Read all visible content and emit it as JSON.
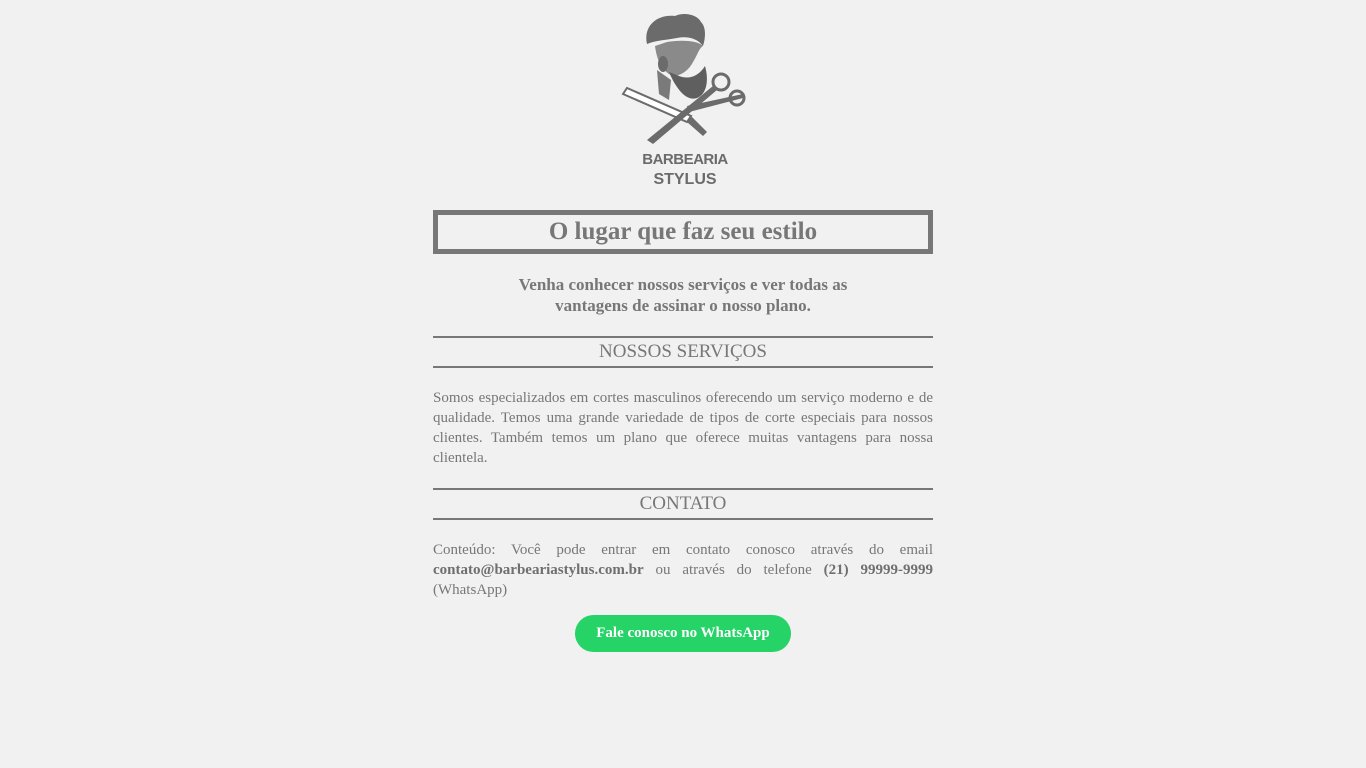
{
  "brand": {
    "line1": "BARBEARIA",
    "line2": "STYLUS"
  },
  "hero": {
    "headline": "O lugar que faz seu estilo",
    "intro_line1": "Venha conhecer nossos serviços e ver todas as",
    "intro_line2": "vantagens de assinar o nosso plano."
  },
  "services": {
    "title": "NOSSOS SERVIÇOS",
    "text": "Somos especializados em cortes masculinos oferecendo um serviço moderno e de qualidade. Temos uma grande variedade de tipos de corte especiais para nossos clientes. Também temos um plano que oferece muitas vantagens para nossa clientela."
  },
  "contact": {
    "title": "CONTATO",
    "text_before_email": "Conteúdo: Você pode entrar em contato conosco através do email ",
    "email": "contato@barbeariastylus.com.br",
    "text_between": " ou através do telefone ",
    "phone": "(21) 99999-9999",
    "text_after": " (WhatsApp)"
  },
  "whatsapp_button": {
    "label": "Fale conosco no WhatsApp",
    "color": "#25d366"
  },
  "colors": {
    "background": "#f1f1f1",
    "text": "#777777"
  },
  "icons": {
    "logo": "barber-logo-icon"
  }
}
